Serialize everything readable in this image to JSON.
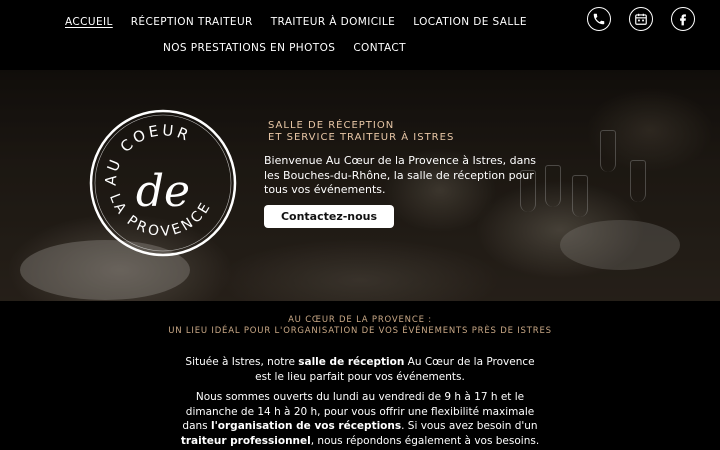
{
  "nav": {
    "items": [
      {
        "label": "ACCUEIL",
        "active": true
      },
      {
        "label": "RÉCEPTION TRAITEUR",
        "active": false
      },
      {
        "label": "TRAITEUR À DOMICILE",
        "active": false
      },
      {
        "label": "LOCATION DE SALLE",
        "active": false
      },
      {
        "label": "NOS PRESTATIONS EN PHOTOS",
        "active": false
      },
      {
        "label": "CONTACT",
        "active": false
      }
    ]
  },
  "social": {
    "icons": [
      "phone-icon",
      "calendar-icon",
      "facebook-icon"
    ]
  },
  "logo": {
    "line_top": "AU COEUR",
    "line_mid": "de",
    "line_bottom": "LA PROVENCE"
  },
  "hero": {
    "kicker_line1": "SALLE DE RÉCEPTION",
    "kicker_line2": "ET SERVICE TRAITEUR À ISTRES",
    "description": "Bienvenue Au Cœur de la Provence à Istres, dans les Bouches-du-Rhône, la salle de réception pour tous vos événements.",
    "cta_label": "Contactez-nous"
  },
  "content": {
    "kicker_line1": "AU CŒUR DE LA PROVENCE :",
    "kicker_line2": "UN LIEU IDÉAL POUR L'ORGANISATION DE VOS ÉVÉNEMENTS PRÈS DE ISTRES",
    "p1_a": "Située à Istres, notre ",
    "p1_b": "salle de réception",
    "p1_c": " Au Cœur de la Provence est le lieu parfait pour vos événements.",
    "p2_a": "Nous sommes ouverts du lundi au vendredi de 9 h à 17 h et le dimanche de 14 h à 20 h, pour vous offrir une flexibilité maximale dans ",
    "p2_b": "l'organisation de vos réceptions",
    "p2_c": ". Si vous avez besoin d'un ",
    "p2_d": "traiteur professionnel",
    "p2_e": ", nous répondons également à vos besoins."
  },
  "colors": {
    "accent": "#e8c7a6",
    "background": "#000000",
    "button_bg": "#ffffff"
  }
}
